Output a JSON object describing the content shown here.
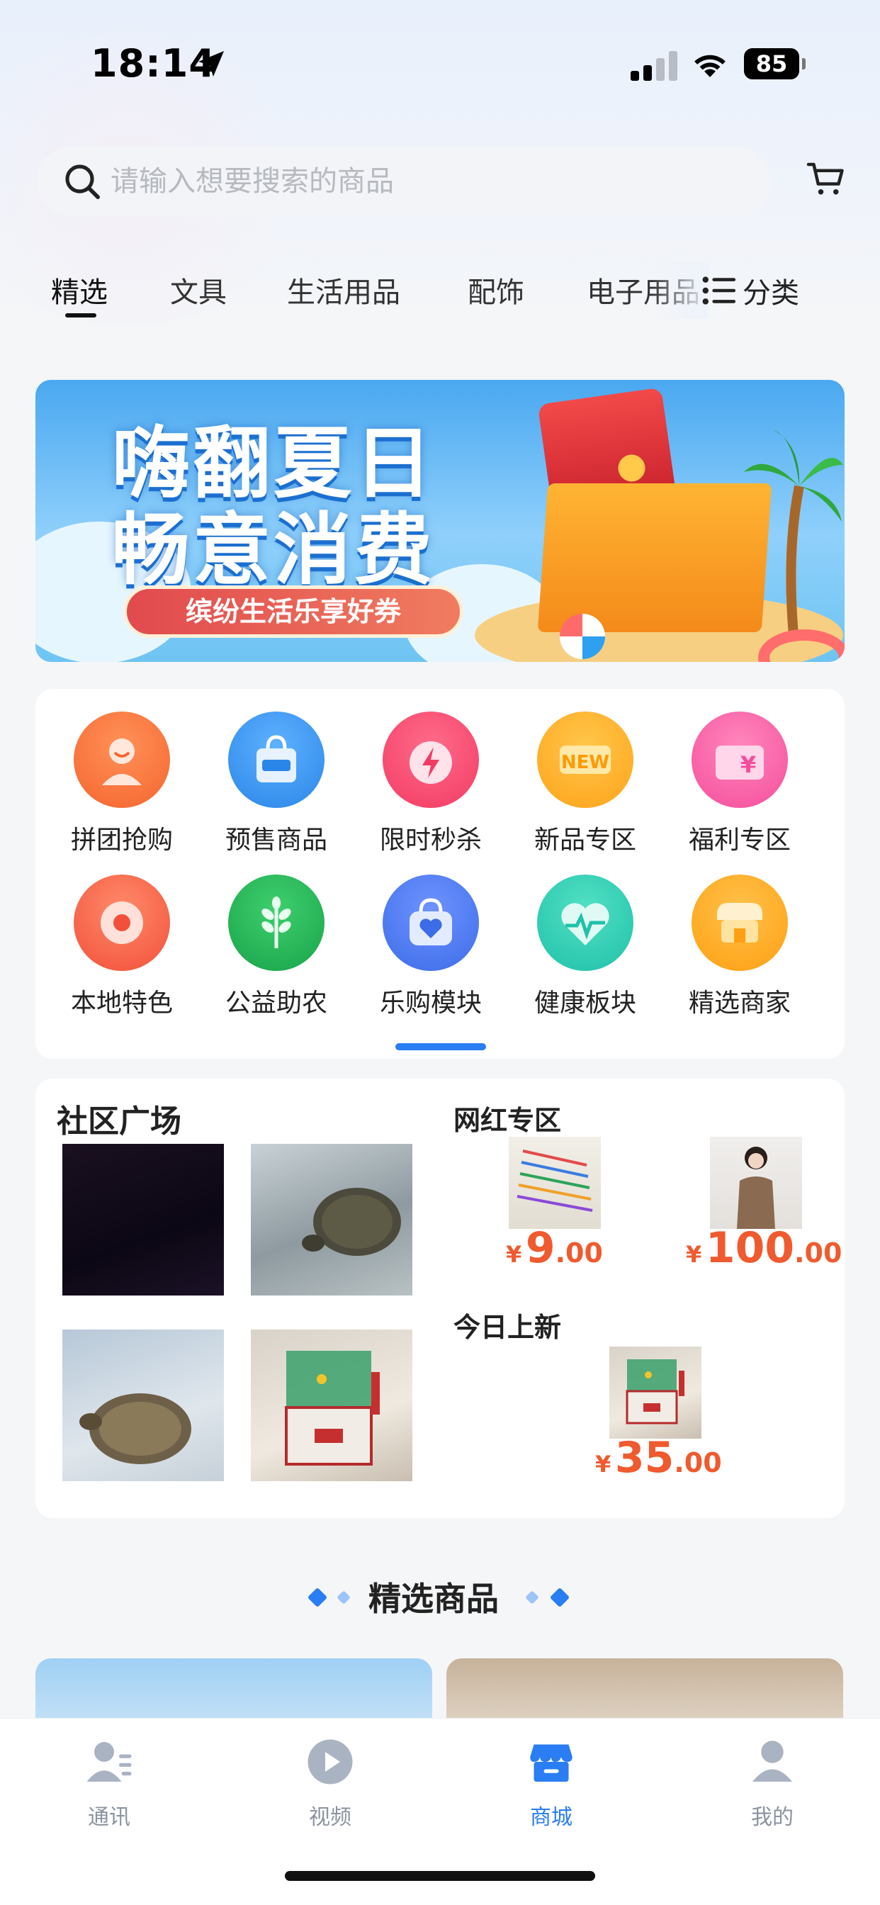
{
  "status_bar": {
    "time": "18:14",
    "battery": "85"
  },
  "search": {
    "placeholder": "请输入想要搜索的商品"
  },
  "tabs": [
    {
      "label": "精选",
      "active": true
    },
    {
      "label": "文具"
    },
    {
      "label": "生活用品"
    },
    {
      "label": "配饰"
    },
    {
      "label": "电子用品"
    }
  ],
  "category_label": "分类",
  "banner": {
    "line1": "嗨翻夏日",
    "line2": "畅意消费",
    "pill": "缤纷生活乐享好券"
  },
  "quick_entries": [
    {
      "label": "拼团抢购",
      "icon": "group-buy-icon",
      "color": "#f5652f"
    },
    {
      "label": "预售商品",
      "icon": "presale-bag-icon",
      "color": "#2a86e8"
    },
    {
      "label": "限时秒杀",
      "icon": "alarm-clock-icon",
      "color": "#f23b63"
    },
    {
      "label": "新品专区",
      "icon": "new-badge-icon",
      "color": "#ffa31a"
    },
    {
      "label": "福利专区",
      "icon": "welfare-card-icon",
      "color": "#f54e9c"
    },
    {
      "label": "本地特色",
      "icon": "location-pin-icon",
      "color": "#f2503a"
    },
    {
      "label": "公益助农",
      "icon": "wheat-icon",
      "color": "#18a34a"
    },
    {
      "label": "乐购模块",
      "icon": "shopping-bag-heart-icon",
      "color": "#3c6ce8"
    },
    {
      "label": "健康板块",
      "icon": "heart-pulse-icon",
      "color": "#1fc1a9"
    },
    {
      "label": "精选商家",
      "icon": "storefront-icon",
      "color": "#ff9f12"
    }
  ],
  "community": {
    "title": "社区广场"
  },
  "trending": {
    "title": "网红专区",
    "items": [
      {
        "yen": "¥",
        "int": "9",
        "dec": ".00"
      },
      {
        "yen": "¥",
        "int": "100",
        "dec": ".00"
      }
    ]
  },
  "new_today": {
    "title": "今日上新",
    "items": [
      {
        "yen": "¥",
        "int": "35",
        "dec": ".00"
      }
    ]
  },
  "featured": {
    "title": "精选商品"
  },
  "bottom_nav": [
    {
      "label": "通讯",
      "icon": "contacts-icon"
    },
    {
      "label": "视频",
      "icon": "play-video-icon"
    },
    {
      "label": "商城",
      "icon": "store-icon",
      "active": true
    },
    {
      "label": "我的",
      "icon": "profile-icon"
    }
  ],
  "colors": {
    "accent": "#2a7df2",
    "price": "#ef5a2e"
  }
}
